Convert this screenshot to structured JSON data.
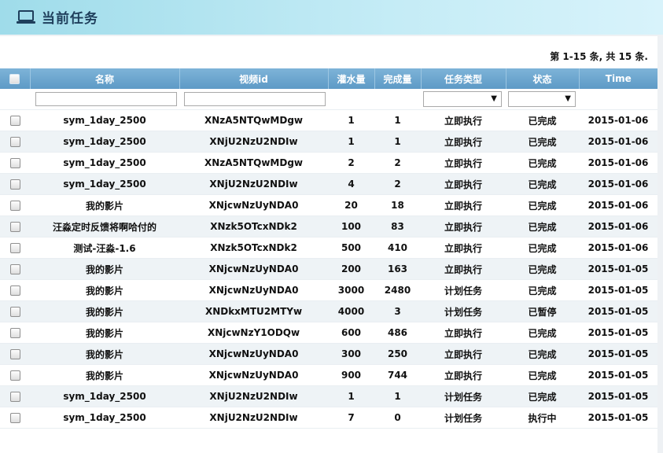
{
  "header": {
    "title": "当前任务",
    "icon": "laptop-icon"
  },
  "summary": "第 1-15 条, 共 15 条.",
  "columns": [
    "名称",
    "视频id",
    "灌水量",
    "完成量",
    "任务类型",
    "状态",
    "Time"
  ],
  "filters": {
    "name_value": "",
    "vid_value": "",
    "type_selected": "",
    "status_selected": ""
  },
  "colors": {
    "plan_task": "#e0201e",
    "header_bg": "#5d9ac6",
    "accent": "#1f3f5c"
  },
  "rows": [
    {
      "name": "sym_1day_2500",
      "vid": "XNzA5NTQwMDgw",
      "water": "1",
      "done": "1",
      "type": "立即执行",
      "status": "已完成",
      "time": "2015-01-06"
    },
    {
      "name": "sym_1day_2500",
      "vid": "XNjU2NzU2NDIw",
      "water": "1",
      "done": "1",
      "type": "立即执行",
      "status": "已完成",
      "time": "2015-01-06"
    },
    {
      "name": "sym_1day_2500",
      "vid": "XNzA5NTQwMDgw",
      "water": "2",
      "done": "2",
      "type": "立即执行",
      "status": "已完成",
      "time": "2015-01-06"
    },
    {
      "name": "sym_1day_2500",
      "vid": "XNjU2NzU2NDIw",
      "water": "4",
      "done": "2",
      "type": "立即执行",
      "status": "已完成",
      "time": "2015-01-06"
    },
    {
      "name": "我的影片",
      "vid": "XNjcwNzUyNDA0",
      "water": "20",
      "done": "18",
      "type": "立即执行",
      "status": "已完成",
      "time": "2015-01-06"
    },
    {
      "name": "汪淼定时反馈将啊哈付的",
      "vid": "XNzk5OTcxNDk2",
      "water": "100",
      "done": "83",
      "type": "立即执行",
      "status": "已完成",
      "time": "2015-01-06"
    },
    {
      "name": "测试-汪淼-1.6",
      "vid": "XNzk5OTcxNDk2",
      "water": "500",
      "done": "410",
      "type": "立即执行",
      "status": "已完成",
      "time": "2015-01-06"
    },
    {
      "name": "我的影片",
      "vid": "XNjcwNzUyNDA0",
      "water": "200",
      "done": "163",
      "type": "立即执行",
      "status": "已完成",
      "time": "2015-01-05"
    },
    {
      "name": "我的影片",
      "vid": "XNjcwNzUyNDA0",
      "water": "3000",
      "done": "2480",
      "type": "计划任务",
      "status": "已完成",
      "time": "2015-01-05"
    },
    {
      "name": "我的影片",
      "vid": "XNDkxMTU2MTYw",
      "water": "4000",
      "done": "3",
      "type": "计划任务",
      "status": "已暂停",
      "time": "2015-01-05"
    },
    {
      "name": "我的影片",
      "vid": "XNjcwNzY1ODQw",
      "water": "600",
      "done": "486",
      "type": "立即执行",
      "status": "已完成",
      "time": "2015-01-05"
    },
    {
      "name": "我的影片",
      "vid": "XNjcwNzUyNDA0",
      "water": "300",
      "done": "250",
      "type": "立即执行",
      "status": "已完成",
      "time": "2015-01-05"
    },
    {
      "name": "我的影片",
      "vid": "XNjcwNzUyNDA0",
      "water": "900",
      "done": "744",
      "type": "立即执行",
      "status": "已完成",
      "time": "2015-01-05"
    },
    {
      "name": "sym_1day_2500",
      "vid": "XNjU2NzU2NDIw",
      "water": "1",
      "done": "1",
      "type": "计划任务",
      "status": "已完成",
      "time": "2015-01-05"
    },
    {
      "name": "sym_1day_2500",
      "vid": "XNjU2NzU2NDIw",
      "water": "7",
      "done": "0",
      "type": "计划任务",
      "status": "执行中",
      "time": "2015-01-05"
    }
  ]
}
